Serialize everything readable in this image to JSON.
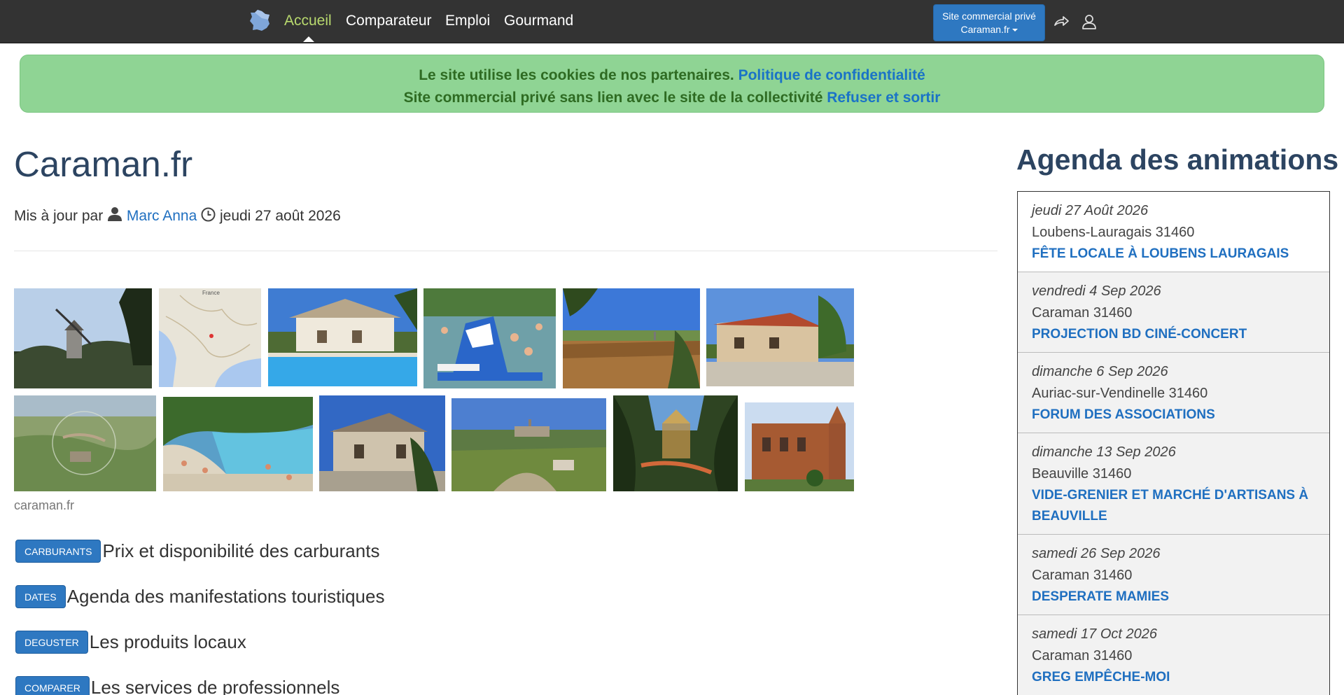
{
  "nav": {
    "logo_icon": "france-map-icon",
    "links": [
      {
        "label": "Accueil",
        "active": true
      },
      {
        "label": "Comparateur"
      },
      {
        "label": "Emploi"
      },
      {
        "label": "Gourmand"
      }
    ],
    "site_button_line1": "Site commercial privé",
    "site_button_line2": "Caraman.fr",
    "share_icon": "share-icon",
    "user_icon": "user-icon"
  },
  "cookie": {
    "line1_text": "Le site utilise les cookies de nos partenaires. ",
    "line1_link": "Politique de confidentialité",
    "line2_text": "Site commercial privé sans lien avec le site de la collectivité ",
    "line2_link": "Refuser et sortir"
  },
  "main": {
    "title": "Caraman.fr",
    "meta_prefix": "Mis à jour par ",
    "author": "Marc Anna",
    "date": "jeudi 27 août 2026",
    "photo_caption": "caraman.fr",
    "categories": [
      {
        "badge": "CARBURANTS",
        "text": "Prix et disponibilité des carburants"
      },
      {
        "badge": "DATES",
        "text": "Agenda des manifestations touristiques"
      },
      {
        "badge": "DEGUSTER",
        "text": "Les produits locaux"
      },
      {
        "badge": "COMPARER",
        "text": "Les services de professionnels"
      }
    ]
  },
  "agenda": {
    "title": "Agenda des animations",
    "items": [
      {
        "date": "jeudi 27 Août 2026",
        "place": "Loubens-Lauragais 31460",
        "event": "Fête locale à Loubens Lauragais"
      },
      {
        "date": "vendredi 4 Sep 2026",
        "place": "Caraman 31460",
        "event": "Projection BD Ciné-Concert"
      },
      {
        "date": "dimanche 6 Sep 2026",
        "place": "Auriac-sur-Vendinelle 31460",
        "event": "Forum des associations"
      },
      {
        "date": "dimanche 13 Sep 2026",
        "place": "Beauville 31460",
        "event": "Vide-grenier et marché d'artisans à Beauville"
      },
      {
        "date": "samedi 26 Sep 2026",
        "place": "Caraman 31460",
        "event": "Desperate Mamies"
      },
      {
        "date": "samedi 17 Oct 2026",
        "place": "Caraman 31460",
        "event": "Greg empêche-moi"
      }
    ]
  }
}
